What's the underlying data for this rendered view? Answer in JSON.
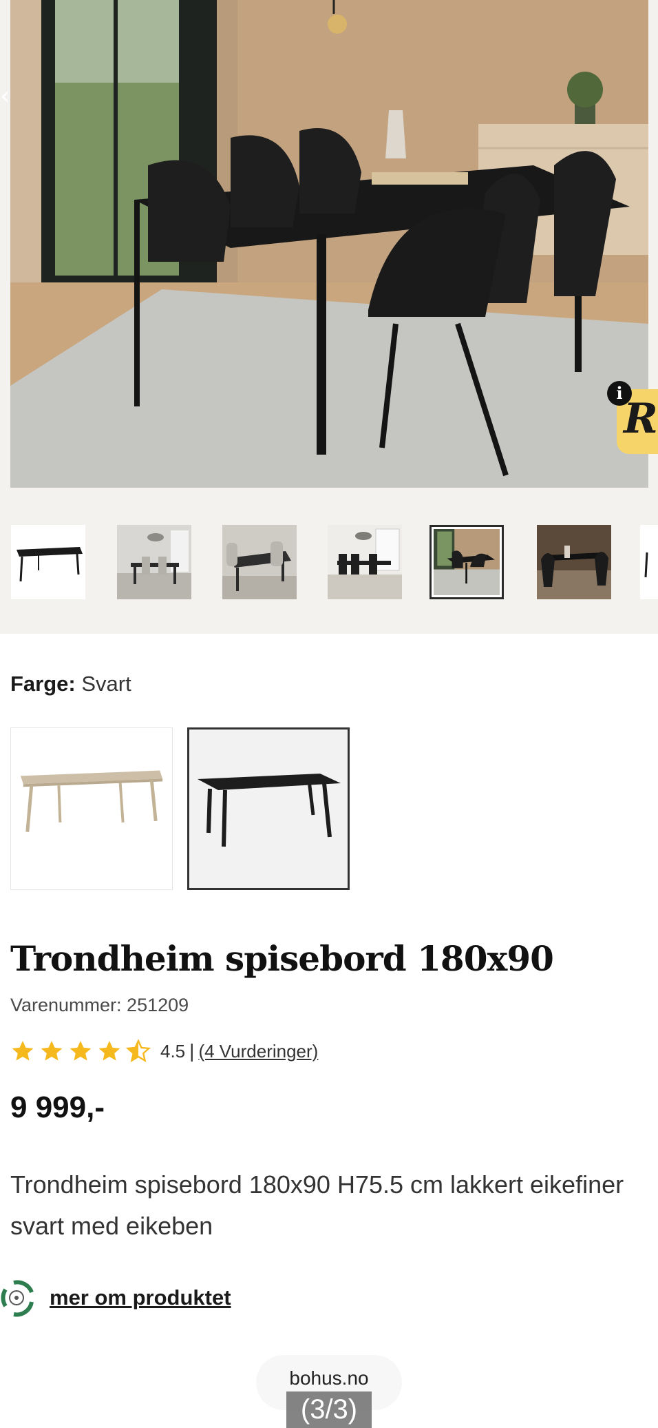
{
  "hero": {
    "image_alt": "",
    "promo_badge": "R",
    "info_icon_glyph": "i"
  },
  "thumbnails": [
    {
      "id": "black-table"
    },
    {
      "id": "grey-room-1"
    },
    {
      "id": "grey-room-2"
    },
    {
      "id": "white-room"
    },
    {
      "id": "dark-room",
      "selected": true
    },
    {
      "id": "black-chairs"
    },
    {
      "id": "partial"
    }
  ],
  "color": {
    "label": "Farge:",
    "value": "Svart",
    "options": [
      "Eik",
      "Svart"
    ],
    "selected_index": 1
  },
  "product": {
    "title": "Trondheim spisebord 180x90",
    "sku": "Varenummer: 251209",
    "rating_value": "4.5",
    "rating_score": 4.5,
    "rating_max": 5,
    "rating_sep": "|",
    "rating_link": "(4 Vurderinger)",
    "price": "9 999,-",
    "description": "Trondheim spisebord 180x90 H75.5 cm lakkert eikefiner svart med eikeben",
    "more_link": "mer om produktet"
  },
  "footer": {
    "source_domain": "bohus.no",
    "page_counter": "(3/3)"
  },
  "colors": {
    "star": "#f5b91e",
    "page_bg": "#f4f2ef",
    "promo": "#f7d46a",
    "eco_green": "#2e7d4f"
  }
}
